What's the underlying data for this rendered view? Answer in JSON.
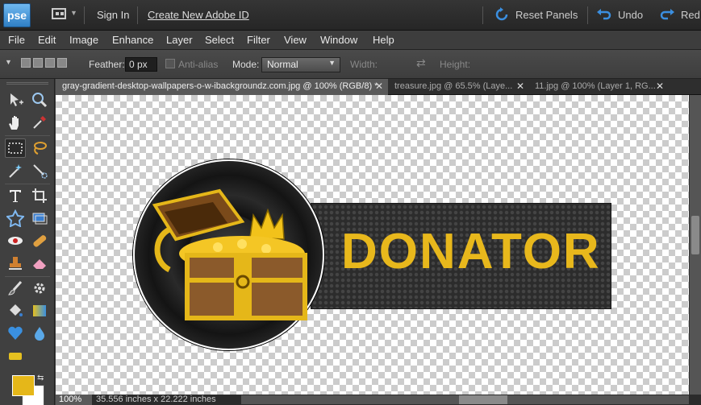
{
  "app": {
    "logo_text": "pse",
    "accent": "#2f7fc4"
  },
  "topbar": {
    "sign_in": "Sign In",
    "create_id": "Create New Adobe ID",
    "reset_panels": "Reset Panels",
    "undo": "Undo",
    "redo": "Red"
  },
  "menu": [
    "File",
    "Edit",
    "Image",
    "Enhance",
    "Layer",
    "Select",
    "Filter",
    "View",
    "Window",
    "Help"
  ],
  "options": {
    "feather_label": "Feather:",
    "feather_value": "0 px",
    "anti_alias": "Anti-alias",
    "mode_label": "Mode:",
    "mode_value": "Normal",
    "width_label": "Width:",
    "height_label": "Height:"
  },
  "tabs": [
    {
      "label": "gray-gradient-desktop-wallpapers-o-w-ibackgroundz.com.jpg @ 100% (RGB/8) *",
      "active": true
    },
    {
      "label": "treasure.jpg @ 65.5% (Laye...",
      "active": false
    },
    {
      "label": "11.jpg @ 100% (Layer 1, RG...",
      "active": false
    }
  ],
  "canvas": {
    "banner_text": "DONATOR",
    "banner_color": "#e8b81c"
  },
  "status": {
    "zoom": "100%",
    "dimensions": "35.556 inches x 22.222 inches"
  },
  "colors": {
    "foreground": "#e5b719",
    "background": "#ffffff"
  }
}
